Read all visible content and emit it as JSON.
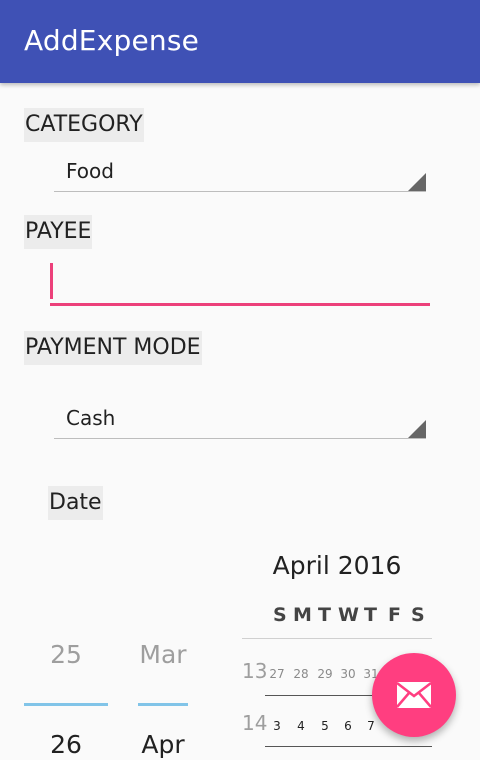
{
  "app_bar": {
    "title": "AddExpense"
  },
  "category": {
    "label": "CATEGORY",
    "selected": "Food"
  },
  "payee": {
    "label": "PAYEE",
    "value": ""
  },
  "payment_mode": {
    "label": "PAYMENT MODE",
    "selected": "Cash"
  },
  "date": {
    "label": "Date",
    "day_picker": {
      "previous": "25",
      "current": "26"
    },
    "month_picker": {
      "previous": "Mar",
      "current": "Apr"
    }
  },
  "calendar": {
    "month_title": "April 2016",
    "weekdays": [
      "S",
      "M",
      "T",
      "W",
      "T",
      "F",
      "S"
    ],
    "weeks": [
      {
        "number": "13",
        "days": [
          "27",
          "28",
          "29",
          "30",
          "31"
        ]
      },
      {
        "number": "14",
        "days": [
          "3",
          "4",
          "5",
          "6",
          "7"
        ]
      }
    ]
  },
  "fab": {
    "icon": "mail-icon",
    "color": "#ff3e80"
  },
  "colors": {
    "primary": "#3f51b5",
    "accent": "#ec407a"
  }
}
